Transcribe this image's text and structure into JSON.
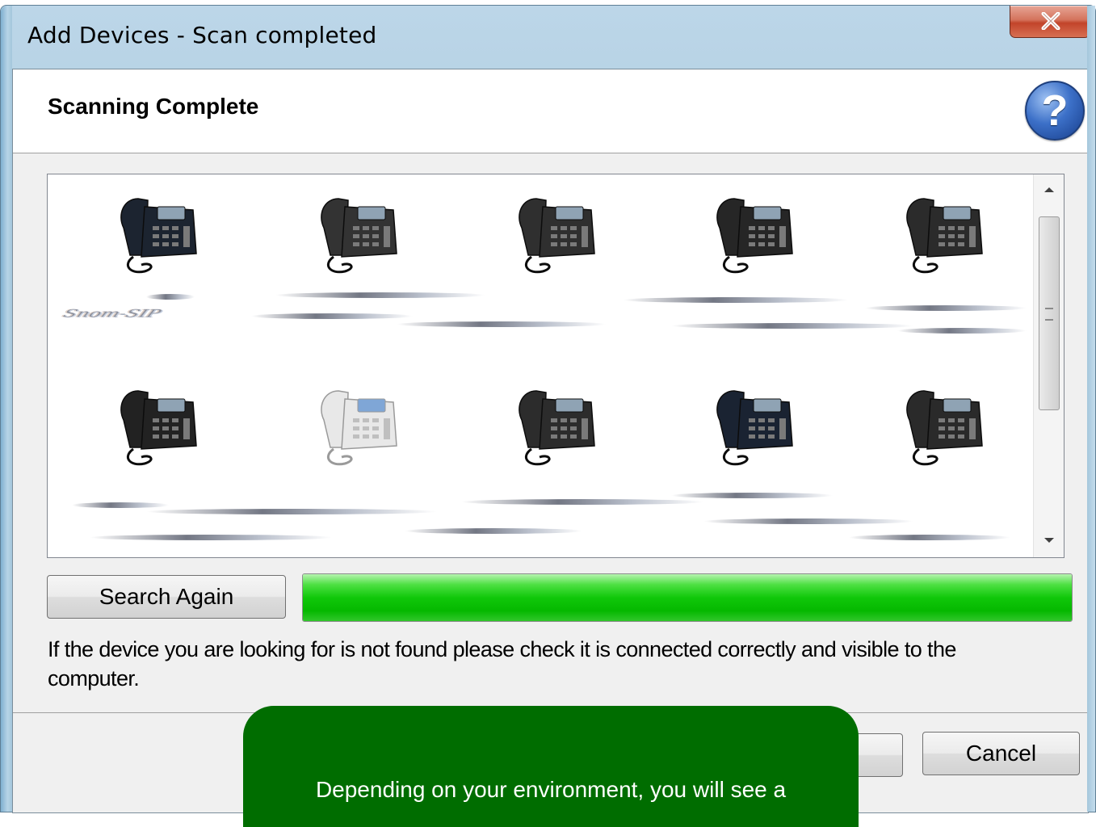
{
  "window": {
    "title": "Add Devices - Scan completed"
  },
  "header": {
    "title": "Scanning Complete"
  },
  "icons": {
    "close": "close-icon",
    "help": "help-icon",
    "phone": "desk-phone-icon",
    "scroll_up": "scroll-up-arrow-icon",
    "scroll_down": "scroll-down-arrow-icon"
  },
  "help_glyph": "?",
  "devices": {
    "row1": [
      {
        "color": "#1c2430"
      },
      {
        "color": "#333333"
      },
      {
        "color": "#2f2f2f"
      },
      {
        "color": "#262626"
      },
      {
        "color": "#2b2b2b"
      }
    ],
    "row2": [
      {
        "color": "#222222"
      },
      {
        "color": "#e8e8e8"
      },
      {
        "color": "#2c2c2c"
      },
      {
        "color": "#1a2332"
      },
      {
        "color": "#2a2a2a"
      }
    ],
    "row1_labels": [
      "Snom-SIP"
    ]
  },
  "actions": {
    "search_again": "Search Again",
    "cancel": "Cancel"
  },
  "progress": {
    "value_percent": 100,
    "color": "#10c80a"
  },
  "info": {
    "message": "If the device you are looking for is not found please check it is connected correctly and visible to the computer."
  },
  "callout": {
    "text": "Depending on your environment, you will see a",
    "color": "#006d00"
  }
}
